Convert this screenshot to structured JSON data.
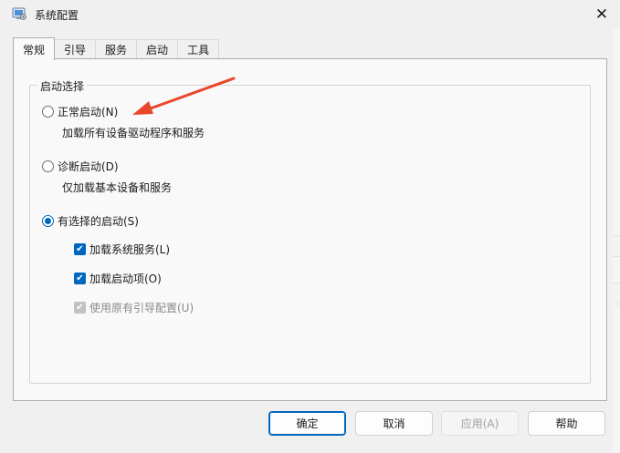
{
  "window": {
    "title": "系统配置"
  },
  "tabs": [
    {
      "label": "常规",
      "active": true
    },
    {
      "label": "引导",
      "active": false
    },
    {
      "label": "服务",
      "active": false
    },
    {
      "label": "启动",
      "active": false
    },
    {
      "label": "工具",
      "active": false
    }
  ],
  "startup": {
    "group_title": "启动选择",
    "normal": {
      "label": "正常启动(N)",
      "desc": "加载所有设备驱动程序和服务",
      "selected": false
    },
    "diagnostic": {
      "label": "诊断启动(D)",
      "desc": "仅加载基本设备和服务",
      "selected": false
    },
    "selective": {
      "label": "有选择的启动(S)",
      "selected": true,
      "options": [
        {
          "label": "加载系统服务(L)",
          "checked": true,
          "enabled": true
        },
        {
          "label": "加载启动项(O)",
          "checked": true,
          "enabled": true
        },
        {
          "label": "使用原有引导配置(U)",
          "checked": true,
          "enabled": false
        }
      ]
    }
  },
  "buttons": {
    "ok": "确定",
    "cancel": "取消",
    "apply": "应用(A)",
    "help": "帮助"
  },
  "colors": {
    "accent": "#0067c0",
    "annotation_arrow": "#e8472a"
  }
}
